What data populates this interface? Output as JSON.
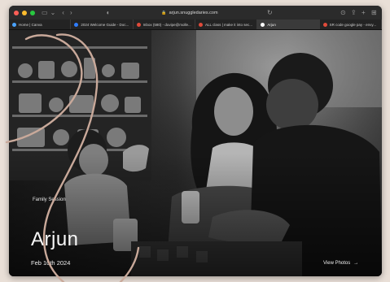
{
  "browser": {
    "url": "arjun.snuggledaries.com",
    "tabs": [
      {
        "label": "Home | Canva",
        "color": "#4aa3ff"
      },
      {
        "label": "2024 Welcome Guide - Doc...",
        "color": "#2f7dff"
      },
      {
        "label": "Inbox (580) - duvipe@molle...",
        "color": "#e04a3a"
      },
      {
        "label": "ALL class | make it into sec...",
        "color": "#e04a3a"
      },
      {
        "label": "Arjun",
        "color": "#ffffff"
      },
      {
        "label": "SR code google pay - envy...",
        "color": "#e04a3a"
      }
    ],
    "active_tab": 4
  },
  "hero": {
    "eyebrow": "Family Session",
    "title": "Arjun",
    "date": "Feb 10th 2024",
    "cta": "View Photos",
    "cta_icon": "arrow-right-icon"
  },
  "colors": {
    "background": "#e9dfd7",
    "decorative_stroke": "#c9a99a"
  }
}
